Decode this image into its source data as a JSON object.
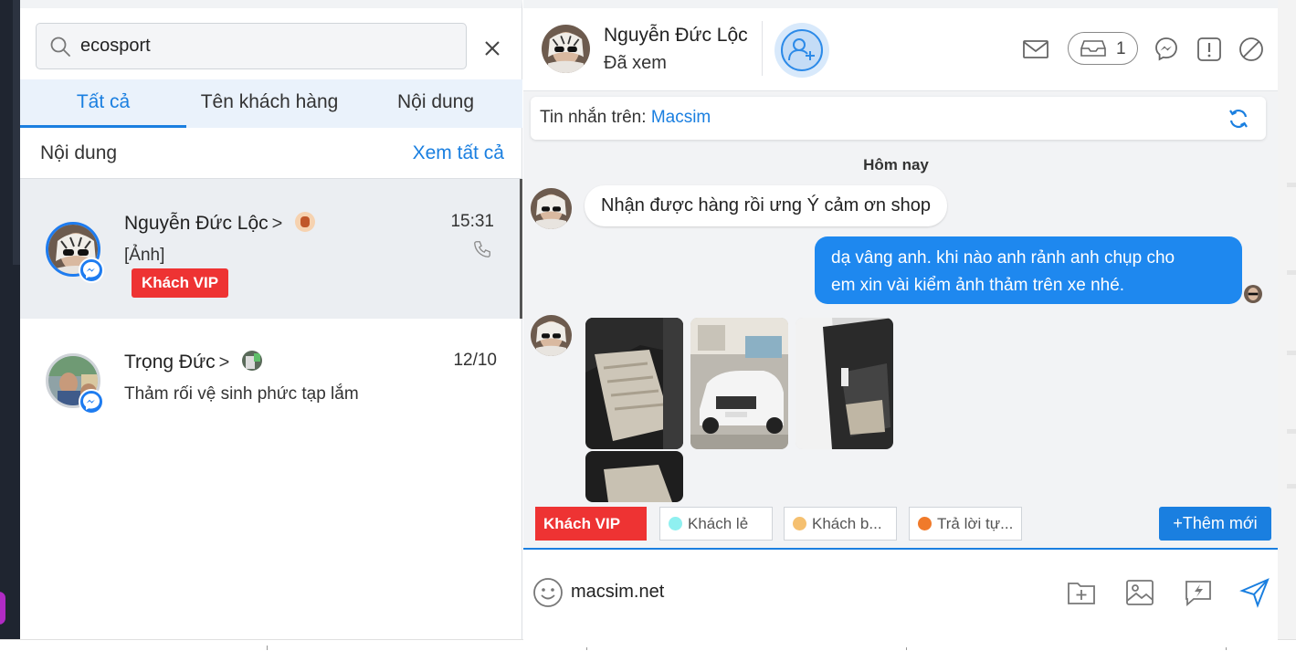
{
  "search": {
    "value": "ecosport",
    "clear_icon": "close-icon"
  },
  "tabs": [
    {
      "label": "Tất cả",
      "active": true
    },
    {
      "label": "Tên khách hàng",
      "active": false
    },
    {
      "label": "Nội dung",
      "active": false
    }
  ],
  "section": {
    "title": "Nội dung",
    "see_all": "Xem tất cả"
  },
  "conversations": [
    {
      "name": "Nguyễn Đức Lộc",
      "chevron": ">",
      "snippet": "[Ảnh]",
      "time": "15:31",
      "tag": "Khách VIP",
      "channel_icon": "messenger-icon"
    },
    {
      "name": "Trọng Đức",
      "chevron": ">",
      "snippet": "Thảm rối vệ sinh phức tạp lắm",
      "time": "12/10",
      "channel_icon": "messenger-icon"
    }
  ],
  "chat_header": {
    "name": "Nguyễn Đức Lộc",
    "status": "Đã xem",
    "inbox_count": "1"
  },
  "channel": {
    "label": "Tin nhắn trên: ",
    "source": "Macsim"
  },
  "day_label": "Hôm nay",
  "messages": [
    {
      "direction": "in",
      "text": "Nhận được hàng rồi ưng Ý cảm ơn shop"
    },
    {
      "direction": "out",
      "line1": "dạ vâng anh. khi nào anh rảnh anh chụp cho",
      "line2": "em xin vài kiểm ảnh thảm trên xe nhé."
    },
    {
      "direction": "in",
      "type": "images",
      "count": 4
    }
  ],
  "quick_tags": [
    {
      "label": "Khách VIP",
      "color": "#ee3333"
    },
    {
      "label": "Khách lẻ",
      "color": "#8ff0f0"
    },
    {
      "label": "Khách b...",
      "color": "#f5c070"
    },
    {
      "label": "Trả lời tự...",
      "color": "#f07a2a"
    }
  ],
  "add_tag_label": "+Thêm mới",
  "composer": {
    "value": "macsim.net"
  },
  "colors": {
    "accent": "#1a7fe0",
    "vip": "#ee3333",
    "bubble_out": "#1e88ef"
  }
}
